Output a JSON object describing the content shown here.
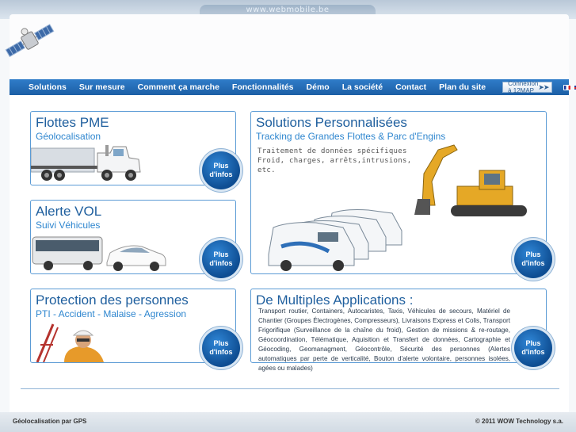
{
  "site": {
    "url": "www.webmobile.be"
  },
  "nav": {
    "items": [
      {
        "label": "Solutions"
      },
      {
        "label": "Sur mesure"
      },
      {
        "label": "Comment ça marche"
      },
      {
        "label": "Fonctionnalités"
      },
      {
        "label": "Démo"
      },
      {
        "label": "La société"
      },
      {
        "label": "Contact"
      },
      {
        "label": "Plan du site"
      }
    ],
    "login_label": "Connexion à 12MAP",
    "languages": [
      "fr-flag-icon",
      "en-flag-icon"
    ]
  },
  "cards": {
    "flottes": {
      "title": "Flottes PME",
      "subtitle": "Géolocalisation",
      "button": [
        "Plus",
        "d'infos"
      ]
    },
    "alerte": {
      "title": "Alerte VOL",
      "subtitle": "Suivi Véhicules",
      "button": [
        "Plus",
        "d'infos"
      ]
    },
    "protection": {
      "title": "Protection des personnes",
      "subtitle": "PTI - Accident - Malaise - Agression",
      "button": [
        "Plus",
        "d'infos"
      ]
    },
    "solutions": {
      "title": "Solutions Personnalisées",
      "subtitle": "Tracking de Grandes Flottes & Parc d'Engins",
      "text": "Traitement de données spécifiques\nFroid, charges, arrêts,intrusions,\netc.",
      "button": [
        "Plus",
        "d'infos"
      ]
    },
    "applications": {
      "title": "De Multiples Applications :",
      "text": "Transport routier, Containers, Autocaristes, Taxis, Véhicules de secours, Matériel de Chantier (Groupes Électrogènes, Compresseurs), Livraisons Express et Colis, Transport Frigorifique (Surveillance de la chaîne du froid), Gestion de missions & re-routage, Géocoordination, Télématique, Aquisition et Transfert de données, Cartographie et Géocoding, Geomanagment, Géocontrôle, Sécurité des personnes (Alertes automatiques par perte de verticalité, Bouton d'alerte volontaire, personnes isolées, agées ou malades)",
      "button": [
        "Plus",
        "d'infos"
      ]
    }
  },
  "footer": {
    "left": "Géolocalisation par GPS",
    "right": "© 2011 WOW Technology s.a."
  },
  "colors": {
    "nav": "#1c5fa5",
    "accent": "#1f5f9e",
    "subtitle": "#2e86cf",
    "button": "#0e4d92"
  }
}
